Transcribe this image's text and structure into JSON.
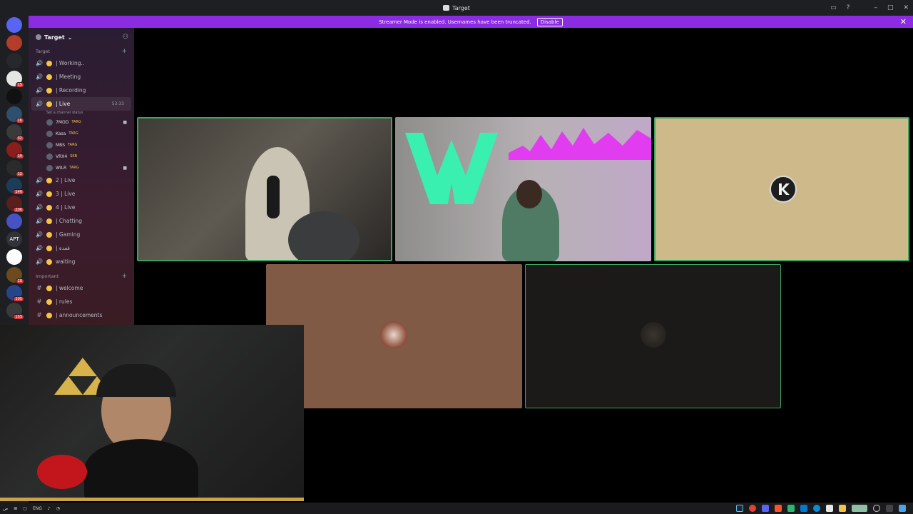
{
  "window": {
    "title": "Target"
  },
  "banner": {
    "message": "Streamer Mode is enabled. Usernames have been truncated.",
    "disable_label": "Disable"
  },
  "rail": {
    "servers": [
      {
        "label": "",
        "color": "#5865f2",
        "badge": ""
      },
      {
        "label": "",
        "color": "#b33c2a",
        "badge": ""
      },
      {
        "label": "",
        "color": "#26282b",
        "badge": ""
      },
      {
        "label": "",
        "color": "#e5e5e5",
        "badge": "15"
      },
      {
        "label": "",
        "color": "#111111",
        "badge": ""
      },
      {
        "label": "",
        "color": "#2f4f6f",
        "badge": "16"
      },
      {
        "label": "",
        "color": "#3a3a3a",
        "badge": "32"
      },
      {
        "label": "",
        "color": "#8c1d1d",
        "badge": "10"
      },
      {
        "label": "",
        "color": "#2b2b2b",
        "badge": "12"
      },
      {
        "label": "",
        "color": "#1c3d5a",
        "badge": "146"
      },
      {
        "label": "",
        "color": "#5a1e1e",
        "badge": "206"
      },
      {
        "label": "",
        "color": "#4752c4",
        "badge": ""
      },
      {
        "label": "APT",
        "color": "#313338",
        "badge": ""
      },
      {
        "label": "",
        "color": "#ffffff",
        "badge": ""
      },
      {
        "label": "",
        "color": "#6b4b1e",
        "badge": "10"
      },
      {
        "label": "",
        "color": "#26448a",
        "badge": "105"
      },
      {
        "label": "",
        "color": "#3a3a3a",
        "badge": "155"
      }
    ]
  },
  "sidebar": {
    "guild_name": "Target",
    "category_1": "Target",
    "voice_channels": [
      {
        "name": "| Working..",
        "timer": ""
      },
      {
        "name": "| Meeting",
        "timer": ""
      },
      {
        "name": "| Recording",
        "timer": ""
      }
    ],
    "live_channel": {
      "name": "| Live",
      "timer": "53:33",
      "status_hint": "Set a channel status"
    },
    "members": [
      {
        "name": "7MOD",
        "tag": "TARG"
      },
      {
        "name": "Kasa",
        "tag": "TARG"
      },
      {
        "name": "MBS",
        "tag": "TARG"
      },
      {
        "name": "VRX4",
        "tag": "SKB"
      },
      {
        "name": "WILR",
        "tag": "TARG"
      }
    ],
    "more_voice": [
      {
        "name": "2 | Live"
      },
      {
        "name": "3 | Live"
      },
      {
        "name": "4 | Live"
      },
      {
        "name": "| Chatting"
      },
      {
        "name": "| Gaming"
      },
      {
        "name": "| قعدة"
      },
      {
        "name": "waiting"
      }
    ],
    "category_2": "Important",
    "text_channels": [
      {
        "name": "| welcome"
      },
      {
        "name": "| rules"
      },
      {
        "name": "| announcements"
      }
    ]
  },
  "taskbar": {
    "lang": "ENG"
  }
}
